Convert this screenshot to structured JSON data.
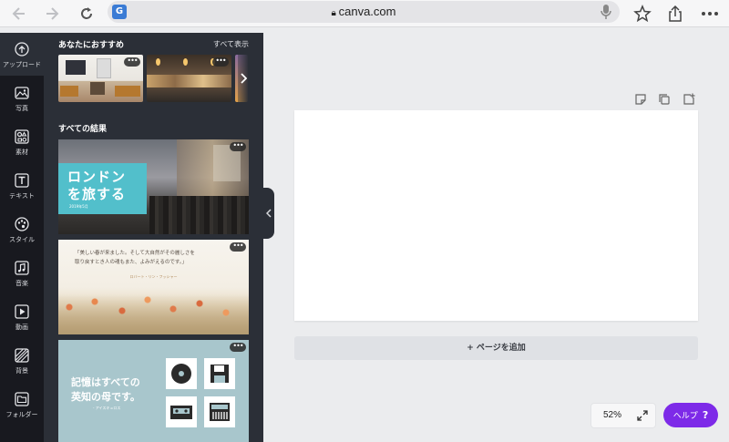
{
  "browser": {
    "url": "canva.com"
  },
  "rail": {
    "items": [
      {
        "label": "アップロード",
        "icon": "upload-icon"
      },
      {
        "label": "写真",
        "icon": "photo-icon"
      },
      {
        "label": "素材",
        "icon": "elements-icon"
      },
      {
        "label": "テキスト",
        "icon": "text-icon"
      },
      {
        "label": "スタイル",
        "icon": "style-icon"
      },
      {
        "label": "音楽",
        "icon": "music-icon"
      },
      {
        "label": "動画",
        "icon": "video-icon"
      },
      {
        "label": "背景",
        "icon": "background-icon"
      },
      {
        "label": "フォルダー",
        "icon": "folder-icon"
      }
    ]
  },
  "panel": {
    "recommended_title": "あなたにおすすめ",
    "see_all": "すべて表示",
    "results_title": "すべての結果",
    "more": "•••",
    "templates": [
      {
        "line1": "ロンドン",
        "line2": "を旅する",
        "small": "2019年5月"
      },
      {
        "line1": "「美しい春が来ました。そして大自然がその麗しさを",
        "line2": "取り戻すとき人の魂もまた、よみがえるのです。」",
        "small": "ロバート・リン・フッシャー"
      },
      {
        "line1": "記憶はすべての",
        "line2": "英知の母です。",
        "small": "- アイスキュロス"
      }
    ]
  },
  "canvas": {
    "add_page": "+ ページを追加",
    "zoom": "52%"
  },
  "help": {
    "label": "ヘルプ",
    "mark": "?"
  },
  "colors": {
    "accent": "#7d2ae8",
    "panel": "#2b2f37",
    "rail": "#18191f"
  }
}
